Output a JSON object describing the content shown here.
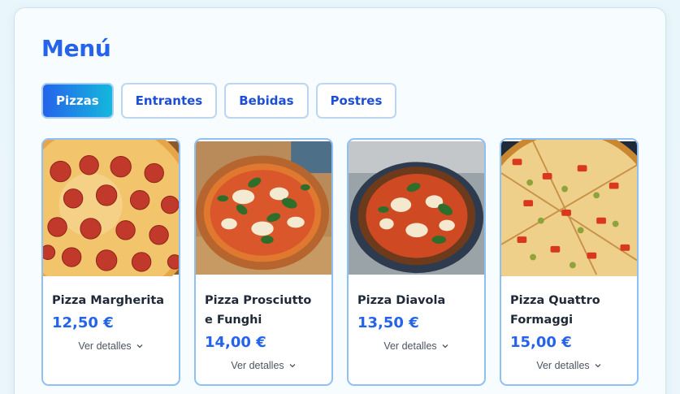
{
  "menu": {
    "title": "Menú"
  },
  "tabs": [
    {
      "label": "Pizzas",
      "active": true
    },
    {
      "label": "Entrantes",
      "active": false
    },
    {
      "label": "Bebidas",
      "active": false
    },
    {
      "label": "Postres",
      "active": false
    }
  ],
  "items": [
    {
      "name": "Pizza Margherita",
      "price": "12,50 €",
      "details_label": "Ver detalles",
      "photo": "pepperoni-pizza-photo"
    },
    {
      "name": "Pizza Prosciutto e Funghi",
      "price": "14,00 €",
      "details_label": "Ver detalles",
      "photo": "basil-pizza-photo"
    },
    {
      "name": "Pizza Diavola",
      "price": "13,50 €",
      "details_label": "Ver detalles",
      "photo": "margherita-pan-photo"
    },
    {
      "name": "Pizza Quattro Formaggi",
      "price": "15,00 €",
      "details_label": "Ver detalles",
      "photo": "olive-tomato-pizza-photo"
    }
  ],
  "colors": {
    "accent": "#2563eb",
    "gradient_end": "#14b8dc",
    "card_border": "#8fc0f5"
  },
  "icons": {
    "details": "chevron-down-icon"
  }
}
